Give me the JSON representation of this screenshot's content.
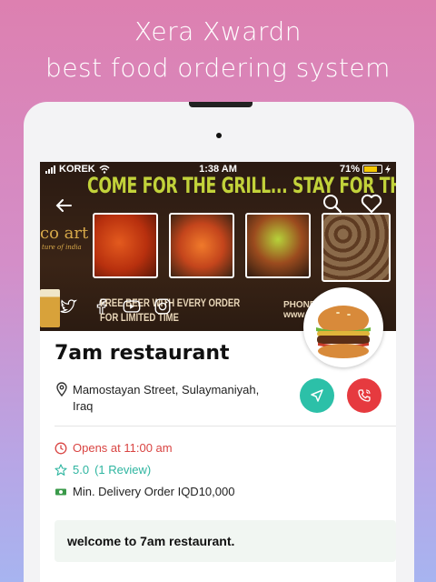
{
  "promo": {
    "line1": "Xera Xwardn",
    "line2": "best food ordering system"
  },
  "status_bar": {
    "carrier": "KOREK",
    "time": "1:38 AM",
    "battery": "71%"
  },
  "banner": {
    "slogan": "COME FOR THE GRILL... STAY FOR THE",
    "brand": "co art",
    "brand_sub": "ture of india",
    "offer_line1": "FREE BEER WITH EVERY ORDER",
    "offer_line2": "FOR LIMITED TIME",
    "phone": "PHONE",
    "phone_sub": "www."
  },
  "restaurant": {
    "name": "7am restaurant",
    "address": "Mamostayan Street, Sulaymaniyah, Iraq",
    "opens": "Opens at 11:00 am",
    "rating": "5.0",
    "reviews": "(1 Review)",
    "min_order": "Min. Delivery Order IQD10,000",
    "welcome": "welcome to 7am restaurant."
  },
  "colors": {
    "accent_teal": "#2cc0a8",
    "accent_red": "#e63a3f",
    "open_red": "#d94442"
  }
}
